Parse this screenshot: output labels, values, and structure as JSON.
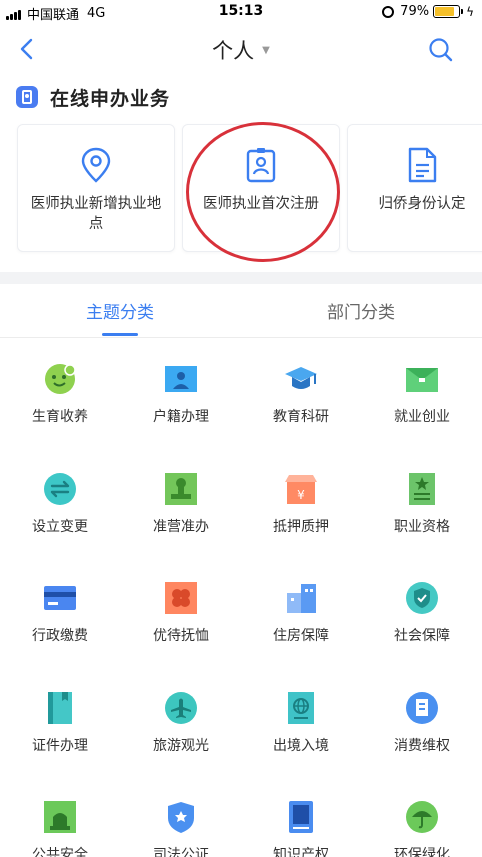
{
  "status_bar": {
    "carrier": "中国联通",
    "network": "4G",
    "time": "15:13",
    "battery": "79%"
  },
  "nav": {
    "title": "个人"
  },
  "section": {
    "title": "在线申办业务"
  },
  "cards": [
    {
      "label": "医师执业新增执业地点",
      "icon": "location-pin-icon"
    },
    {
      "label": "医师执业首次注册",
      "icon": "id-badge-icon"
    },
    {
      "label": "归侨身份认定",
      "icon": "document-icon"
    }
  ],
  "tabs": {
    "active": "主题分类",
    "inactive": "部门分类"
  },
  "categories": [
    {
      "label": "生育收养",
      "icon": "baby-icon",
      "color": "#8fd14f"
    },
    {
      "label": "户籍办理",
      "icon": "household-icon",
      "color": "#3ba9f2"
    },
    {
      "label": "教育科研",
      "icon": "graduation-cap-icon",
      "color": "#4aa7ef"
    },
    {
      "label": "就业创业",
      "icon": "briefcase-icon",
      "color": "#5fd07a"
    },
    {
      "label": "设立变更",
      "icon": "exchange-icon",
      "color": "#3dc7c7"
    },
    {
      "label": "准营准办",
      "icon": "stamp-icon",
      "color": "#73c65a"
    },
    {
      "label": "抵押质押",
      "icon": "pawnshop-icon",
      "color": "#ff8a64"
    },
    {
      "label": "职业资格",
      "icon": "certificate-icon",
      "color": "#6cc46a"
    },
    {
      "label": "行政缴费",
      "icon": "credit-card-icon",
      "color": "#4a86f0"
    },
    {
      "label": "优待抚恤",
      "icon": "flower-icon",
      "color": "#ff8660"
    },
    {
      "label": "住房保障",
      "icon": "building-icon",
      "color": "#5a9af3"
    },
    {
      "label": "社会保障",
      "icon": "shield-icon",
      "color": "#45c9c4"
    },
    {
      "label": "证件办理",
      "icon": "booklet-icon",
      "color": "#44c7c7"
    },
    {
      "label": "旅游观光",
      "icon": "airplane-icon",
      "color": "#3dc6bf"
    },
    {
      "label": "出境入境",
      "icon": "passport-icon",
      "color": "#3fc3c8"
    },
    {
      "label": "消费维权",
      "icon": "receipt-icon",
      "color": "#4a90f0"
    },
    {
      "label": "公共安全",
      "icon": "alarm-light-icon",
      "color": "#6cc95a"
    },
    {
      "label": "司法公证",
      "icon": "police-badge-icon",
      "color": "#4a90f0"
    },
    {
      "label": "知识产权",
      "icon": "book-icon",
      "color": "#4a8cf0"
    },
    {
      "label": "环保绿化",
      "icon": "umbrella-icon",
      "color": "#6cc95a"
    }
  ]
}
